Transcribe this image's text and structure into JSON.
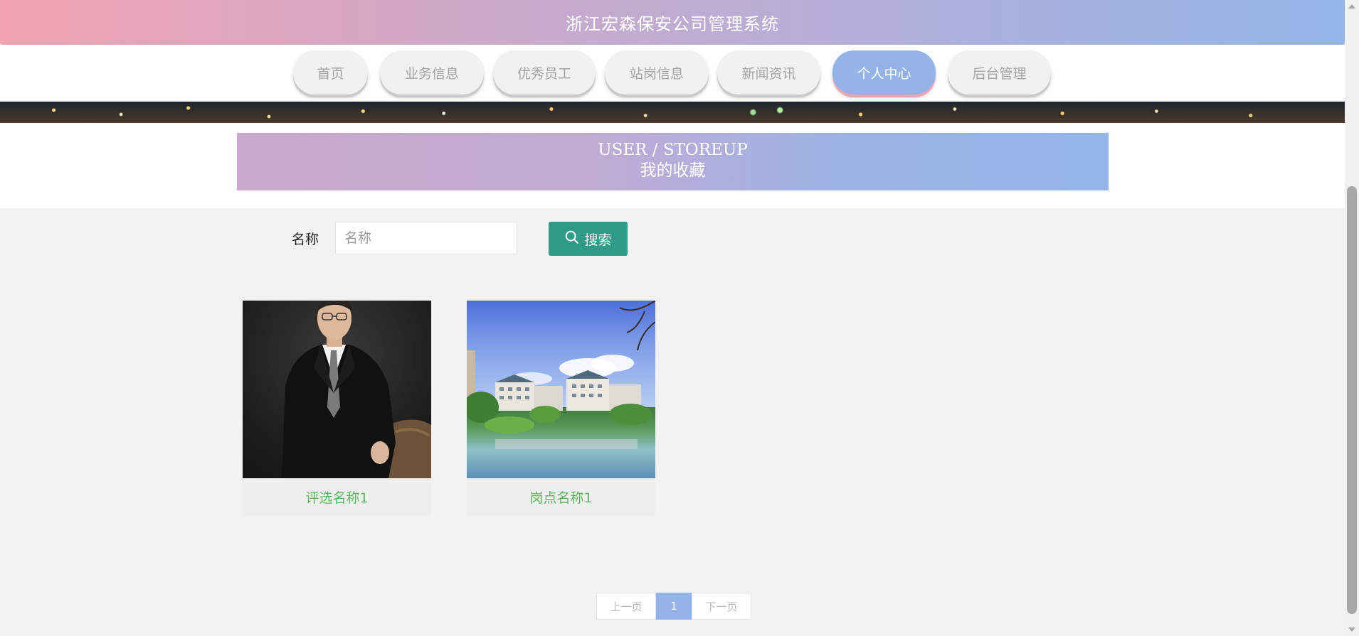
{
  "header": {
    "title": "浙江宏森保安公司管理系统"
  },
  "nav": {
    "items": [
      {
        "label": "首页"
      },
      {
        "label": "业务信息"
      },
      {
        "label": "优秀员工"
      },
      {
        "label": "站岗信息"
      },
      {
        "label": "新闻资讯"
      },
      {
        "label": "个人中心",
        "active": true
      },
      {
        "label": "后台管理"
      }
    ]
  },
  "section": {
    "title_en": "USER / STOREUP",
    "title_cn": "我的收藏"
  },
  "search": {
    "label": "名称",
    "placeholder": "名称",
    "value": "",
    "button_label": "搜索",
    "button_icon": "search-icon"
  },
  "cards": [
    {
      "name": "评选名称1",
      "image": "man-in-suit-photo"
    },
    {
      "name": "岗点名称1",
      "image": "residential-lake-photo"
    }
  ],
  "pagination": {
    "prev_label": "上一页",
    "current_page": "1",
    "next_label": "下一页"
  },
  "colors": {
    "accent": "#94b4e9",
    "pink": "#f2a2b1",
    "search_button": "#2e9a88",
    "card_name": "#5cb85c"
  }
}
